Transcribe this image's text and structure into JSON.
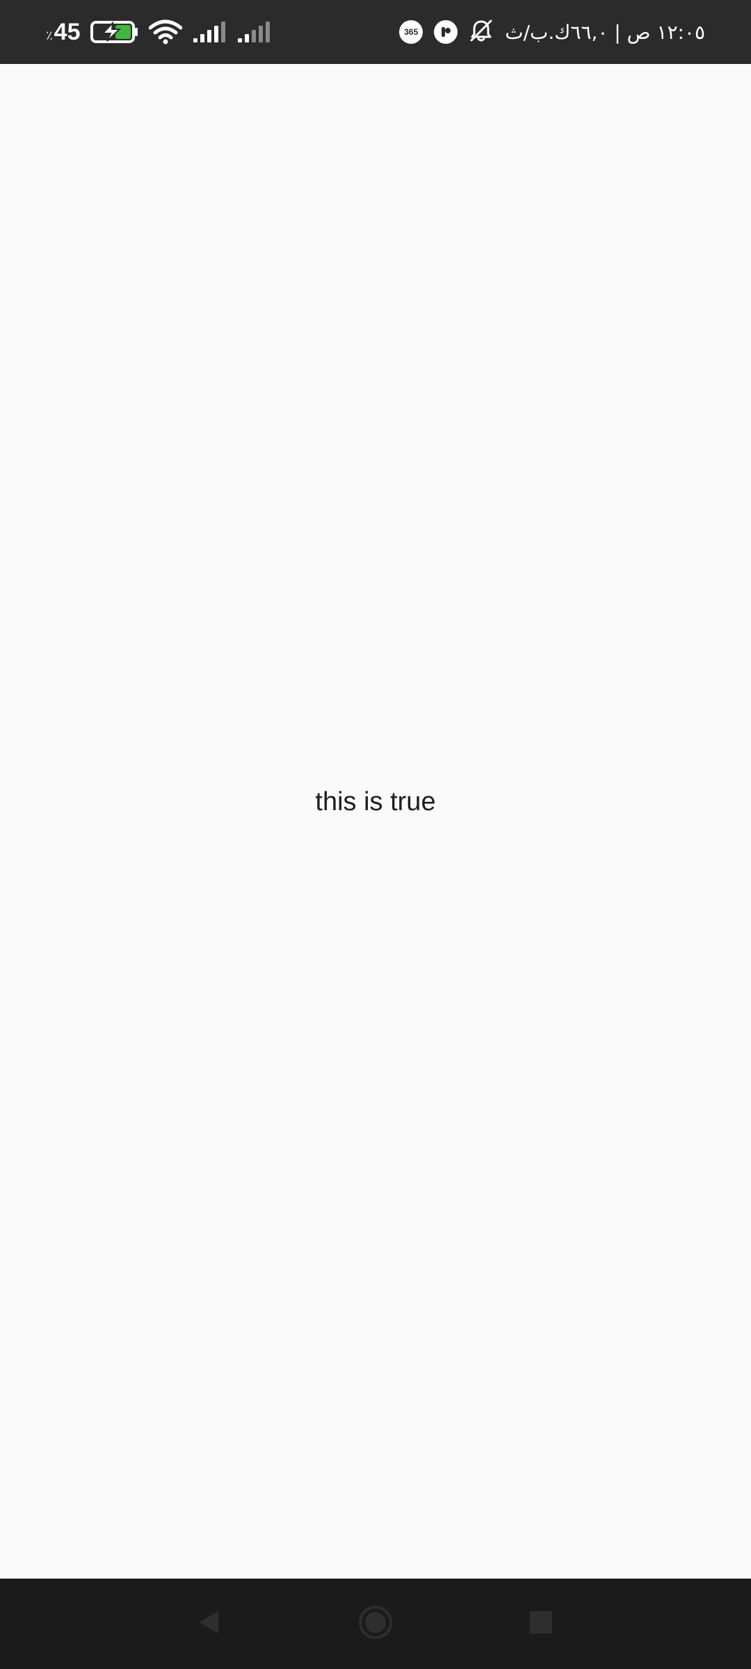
{
  "status_bar": {
    "time_text": "١٢:٠٥ ص | ٦٦,٠ك.ب/ث",
    "battery_level": "45",
    "battery_percent_sign": "٪",
    "icons": [
      "bell-off-icon",
      "app-badge-icon",
      "365-icon",
      "battery-charging-icon",
      "wifi-icon",
      "signal-icon",
      "signal-icon-2"
    ],
    "badge_365": "365",
    "colors": {
      "background": "#2b2b2b",
      "battery_fill": "#3fb83f"
    }
  },
  "main": {
    "message": "this is true",
    "background": "#fafafa"
  },
  "nav_bar": {
    "buttons": [
      "back",
      "home",
      "recents"
    ],
    "background": "#1b1b1b"
  }
}
